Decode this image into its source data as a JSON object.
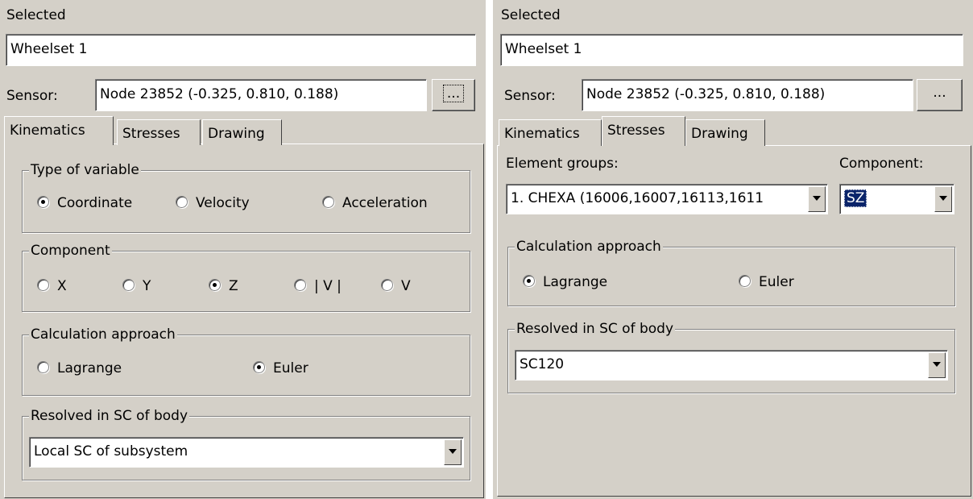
{
  "left": {
    "selected_label": "Selected",
    "selected_value": "Wheelset 1",
    "sensor_label": "Sensor:",
    "sensor_value": "Node 23852 (-0.325,  0.810,  0.188)",
    "browse_label": "...",
    "tabs": [
      "Kinematics",
      "Stresses",
      "Drawing"
    ],
    "active_tab": "Kinematics",
    "type_group": {
      "title": "Type of variable",
      "options": [
        "Coordinate",
        "Velocity",
        "Acceleration"
      ],
      "selected": "Coordinate"
    },
    "component_group": {
      "title": "Component",
      "options": [
        "X",
        "Y",
        "Z",
        "| V |",
        "V"
      ],
      "selected": "Z"
    },
    "calc_group": {
      "title": "Calculation approach",
      "options": [
        "Lagrange",
        "Euler"
      ],
      "selected": "Euler"
    },
    "resolved_group": {
      "title": "Resolved in SC of body",
      "value": "Local SC of subsystem"
    }
  },
  "right": {
    "selected_label": "Selected",
    "selected_value": "Wheelset 1",
    "sensor_label": "Sensor:",
    "sensor_value": "Node 23852 (-0.325,  0.810,  0.188)",
    "browse_label": "...",
    "tabs": [
      "Kinematics",
      "Stresses",
      "Drawing"
    ],
    "active_tab": "Stresses",
    "element_groups_label": "Element groups:",
    "element_groups_value": "1. CHEXA (16006,16007,16113,1611",
    "component_label": "Component:",
    "component_value": "SZ",
    "calc_group": {
      "title": "Calculation approach",
      "options": [
        "Lagrange",
        "Euler"
      ],
      "selected": "Lagrange"
    },
    "resolved_group": {
      "title": "Resolved in SC of body",
      "value": "SC120"
    }
  },
  "colors": {
    "face": "#d4d0c8",
    "highlight": "#0a246a"
  }
}
